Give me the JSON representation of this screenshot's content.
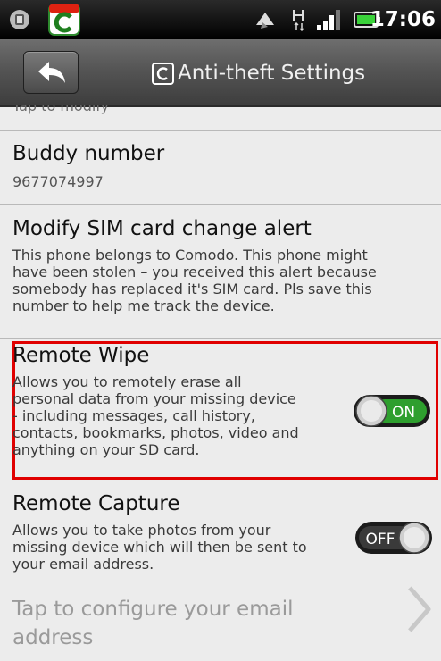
{
  "status_bar": {
    "time": "17:06",
    "icons": [
      "android-notification-icon",
      "comodo-app-icon",
      "sync-icon",
      "network-h-icon",
      "signal-icon",
      "battery-icon"
    ]
  },
  "header": {
    "title": "Anti-theft Settings",
    "back_icon": "back-arrow-icon",
    "logo_letter": "C"
  },
  "settings": {
    "clipped_hint": "Tap to modify",
    "buddy": {
      "title": "Buddy number",
      "value": "9677074997"
    },
    "sim_alert": {
      "title": "Modify SIM card change alert",
      "lines": [
        "This phone belongs to Comodo. This phone might",
        "have been stolen – you received this alert because",
        "somebody has replaced it's SIM card. Pls save this",
        "number to help me track the device."
      ]
    },
    "remote_wipe": {
      "title": "Remote Wipe",
      "lines": [
        "Allows you to remotely erase all",
        "personal data from your missing device",
        "- including messages, call history,",
        "contacts, bookmarks, photos, video and",
        "anything on your SD card."
      ],
      "toggle_label": "ON",
      "state": "on"
    },
    "remote_capture": {
      "title": "Remote Capture",
      "lines": [
        "Allows you to take photos from your",
        "missing device which will then be sent to",
        "your email address."
      ],
      "toggle_label": "OFF",
      "state": "off"
    },
    "email": {
      "lines": [
        "Tap to configure your email",
        "address"
      ],
      "chevron_icon": "chevron-right-icon"
    }
  },
  "colors": {
    "highlight_border": "#e00000",
    "toggle_on": "#2e9f2e",
    "toggle_off": "#3a3a3a"
  }
}
